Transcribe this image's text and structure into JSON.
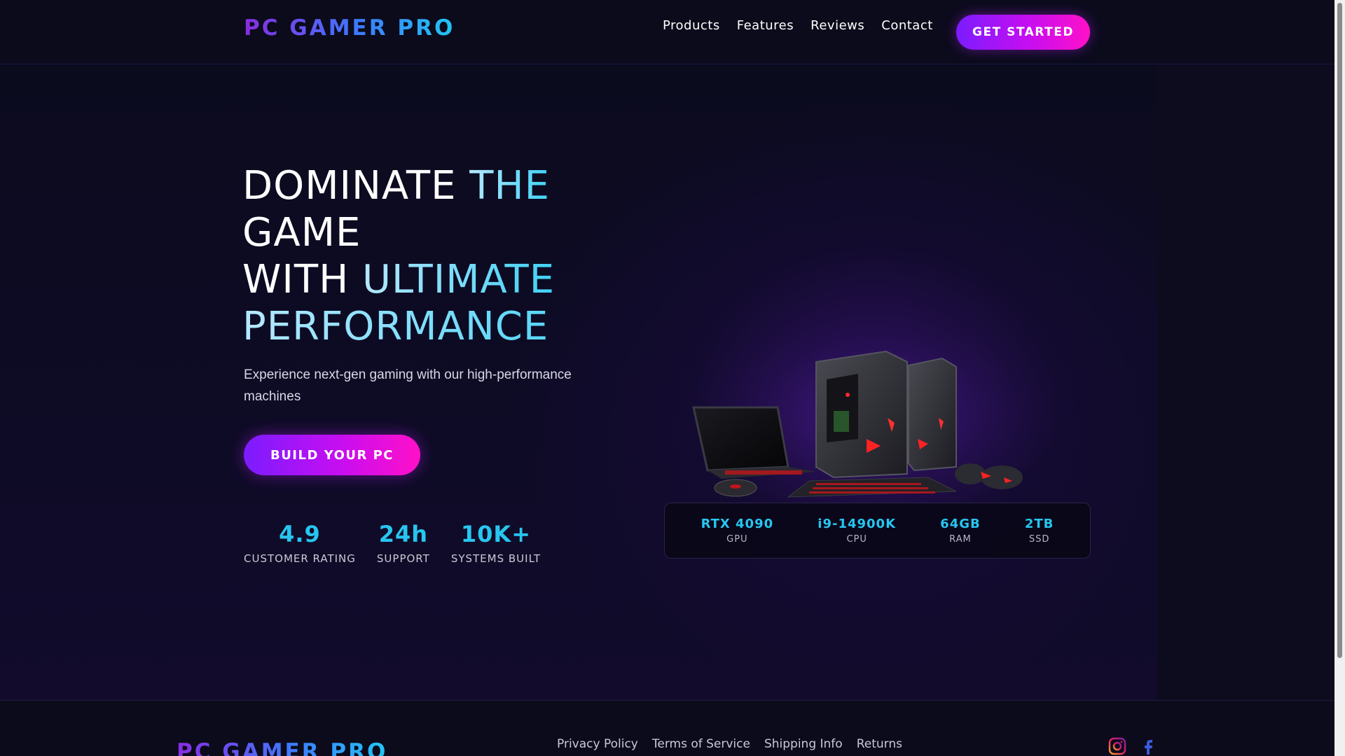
{
  "header": {
    "logo": "PC GAMER PRO",
    "nav": [
      "Products",
      "Features",
      "Reviews",
      "Contact"
    ],
    "cta": "GET STARTED"
  },
  "hero": {
    "headline_line1_plain": "DOMINATE ",
    "headline_line1_accent": "THE",
    "headline_line2_plain": "GAME",
    "headline_line3_plain": "WITH ",
    "headline_line3_accent": "ULTIMATE",
    "headline_line4_accent": "PERFORMANCE",
    "subtitle": "Experience next-gen gaming with our high-performance machines",
    "build_button": "BUILD YOUR PC",
    "stats": [
      {
        "value": "4.9",
        "label": "CUSTOMER RATING"
      },
      {
        "value": "24h",
        "label": "SUPPORT"
      },
      {
        "value": "10K+",
        "label": "SYSTEMS BUILT"
      }
    ],
    "specs": [
      {
        "value": "RTX 4090",
        "label": "GPU"
      },
      {
        "value": "i9-14900K",
        "label": "CPU"
      },
      {
        "value": "64GB",
        "label": "RAM"
      },
      {
        "value": "2TB",
        "label": "SSD"
      }
    ]
  },
  "footer": {
    "logo": "PC GAMER PRO",
    "links": [
      "Privacy Policy",
      "Terms of Service",
      "Shipping Info",
      "Returns"
    ],
    "social_icons": [
      "instagram-icon",
      "facebook-icon"
    ]
  },
  "colors": {
    "background": "#0b0b1e",
    "accent_cyan": "#27c6f0",
    "accent_purple": "#7b1cff",
    "accent_pink": "#ff10c8"
  }
}
